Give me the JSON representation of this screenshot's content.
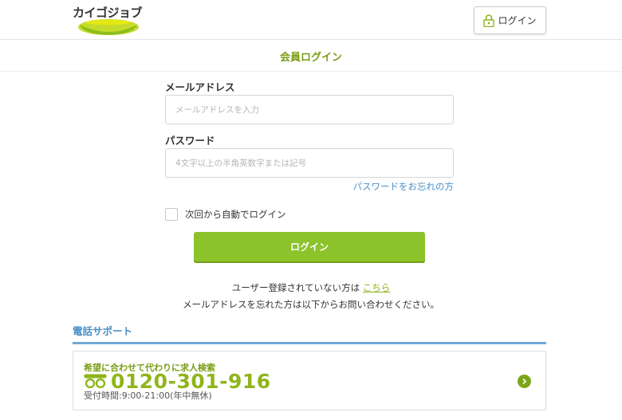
{
  "header": {
    "logo_text": "カイゴジョブ",
    "login_button_label": "ログイン"
  },
  "page": {
    "title": "会員ログイン"
  },
  "form": {
    "email_label": "メールアドレス",
    "email_placeholder": "メールアドレスを入力",
    "email_value": "",
    "password_label": "パスワード",
    "password_placeholder": "4文字以上の半角英数字または記号",
    "password_value": "",
    "forgot_password_link": "パスワードをお忘れの方",
    "remember_label": "次回から自動でログイン",
    "remember_checked": false,
    "submit_label": "ログイン"
  },
  "register": {
    "prefix": "ユーザー登録されていない方は",
    "link": "こちら",
    "contact_text": "メールアドレスを忘れた方は以下からお問い合わせください。"
  },
  "support": {
    "heading": "電話サポート",
    "caption": "希望に合わせて代わりに求人検索",
    "phone": "0120-301-916",
    "hours": "受付時間:9:00-21:00(年中無休)"
  },
  "colors": {
    "brand_green": "#8cc22a",
    "title_green": "#7a9c14",
    "link_blue": "#4a90c8",
    "support_line": "#6fa9d9"
  },
  "icons": {
    "logo": "kaigojob-logo-mark",
    "login": "lock-icon",
    "phone": "freedial-icon",
    "arrow": "chevron-right-icon"
  }
}
